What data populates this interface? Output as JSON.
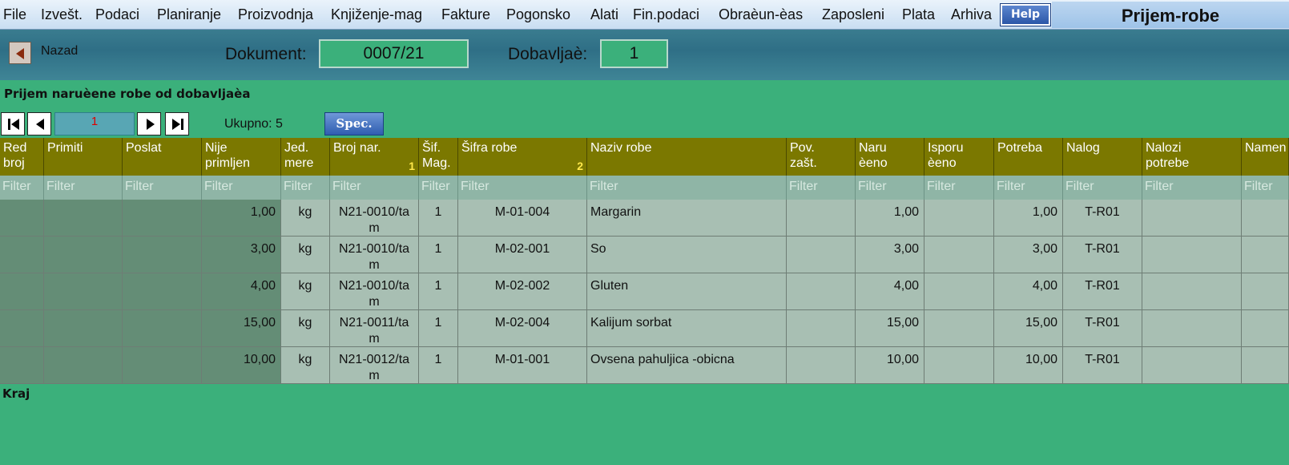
{
  "menu": [
    "File",
    "Izvešt.",
    "Podaci",
    "Planiranje",
    "Proizvodnja",
    "Knjiženje-mag",
    "Fakture",
    "Pogonsko",
    "Alati",
    "Fin.podaci",
    "Obraèun-èas",
    "Zaposleni",
    "Plata",
    "Arhiva"
  ],
  "help_label": "Help",
  "window_title": "Prijem-robe",
  "back_label": "Nazad",
  "dokument_label": "Dokument:",
  "dokument_value": "0007/21",
  "dobavljac_label": "Dobavljaè:",
  "dobavljac_value": "1",
  "subtitle": "Prijem naruèene robe od dobavljaèa",
  "nav": {
    "page": "1",
    "total_label": "Ukupno: 5",
    "spec_label": "Spec."
  },
  "columns": [
    {
      "l1": "Red",
      "l2": "broj",
      "sort": ""
    },
    {
      "l1": "Primiti",
      "l2": "",
      "sort": ""
    },
    {
      "l1": "Poslat",
      "l2": "",
      "sort": ""
    },
    {
      "l1": "Nije",
      "l2": "primljen",
      "sort": ""
    },
    {
      "l1": "Jed.",
      "l2": "mere",
      "sort": ""
    },
    {
      "l1": "Broj nar.",
      "l2": "",
      "sort": "1"
    },
    {
      "l1": "Šif.",
      "l2": "Mag.",
      "sort": ""
    },
    {
      "l1": "Šifra robe",
      "l2": "",
      "sort": "2"
    },
    {
      "l1": "Naziv robe",
      "l2": "",
      "sort": ""
    },
    {
      "l1": "Pov.",
      "l2": "zašt.",
      "sort": ""
    },
    {
      "l1": "Naru",
      "l2": "èeno",
      "sort": ""
    },
    {
      "l1": "Isporu",
      "l2": "èeno",
      "sort": ""
    },
    {
      "l1": "Potreba",
      "l2": "",
      "sort": ""
    },
    {
      "l1": "Nalog",
      "l2": "",
      "sort": ""
    },
    {
      "l1": "Nalozi",
      "l2": "potrebe",
      "sort": ""
    },
    {
      "l1": "Namen",
      "l2": "",
      "sort": ""
    }
  ],
  "filter_placeholder": "Filter",
  "rows": [
    {
      "nije": "1,00",
      "jed": "kg",
      "broj1": "N21-0010/ta",
      "broj2": "m",
      "mag": "1",
      "sifra": "M-01-004",
      "naziv": "Margarin",
      "naruceno": "1,00",
      "potreba": "1,00",
      "nalog": "T-R01"
    },
    {
      "nije": "3,00",
      "jed": "kg",
      "broj1": "N21-0010/ta",
      "broj2": "m",
      "mag": "1",
      "sifra": "M-02-001",
      "naziv": "So",
      "naruceno": "3,00",
      "potreba": "3,00",
      "nalog": "T-R01"
    },
    {
      "nije": "4,00",
      "jed": "kg",
      "broj1": "N21-0010/ta",
      "broj2": "m",
      "mag": "1",
      "sifra": "M-02-002",
      "naziv": "Gluten",
      "naruceno": "4,00",
      "potreba": "4,00",
      "nalog": "T-R01"
    },
    {
      "nije": "15,00",
      "jed": "kg",
      "broj1": "N21-0011/ta",
      "broj2": "m",
      "mag": "1",
      "sifra": "M-02-004",
      "naziv": "Kalijum sorbat",
      "naruceno": "15,00",
      "potreba": "15,00",
      "nalog": "T-R01"
    },
    {
      "nije": "10,00",
      "jed": "kg",
      "broj1": "N21-0012/ta",
      "broj2": "m",
      "mag": "1",
      "sifra": "M-01-001",
      "naziv": "Ovsena pahuljica -obicna",
      "naruceno": "10,00",
      "potreba": "10,00",
      "nalog": "T-R01"
    }
  ],
  "footer": "Kraj"
}
